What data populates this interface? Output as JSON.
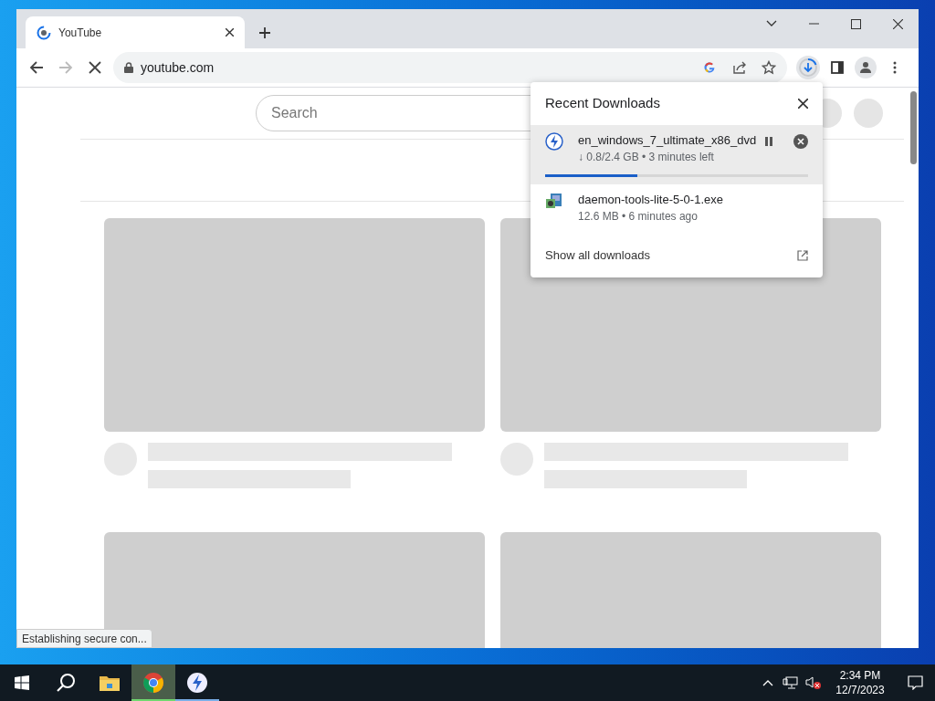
{
  "browser": {
    "tabs": [
      {
        "title": "YouTube",
        "selected": true
      }
    ],
    "address": "youtube.com",
    "loading": true
  },
  "page": {
    "search": {
      "placeholder": "Search"
    }
  },
  "downloads_popup": {
    "title": "Recent Downloads",
    "items": [
      {
        "kind": "in_progress",
        "name": "en_windows_7_ultimate_x86_dvd",
        "status": "↓ 0.8/2.4 GB • 3 minutes left",
        "level": 0.35,
        "highlighted": true
      },
      {
        "kind": "complete",
        "name": "daemon-tools-lite-5-0-1.exe",
        "status": "12.6 MB • 6 minutes ago",
        "highlighted": false
      }
    ],
    "footer": "Show all downloads"
  },
  "status_bubble": "Establishing secure con...",
  "taskbar": {
    "apps": [
      {
        "kind": "explorer",
        "selected": false,
        "running": false
      },
      {
        "kind": "chrome",
        "selected": true,
        "running": true
      },
      {
        "kind": "daemon",
        "selected": false,
        "running": true
      }
    ],
    "time": "2:34 PM",
    "date": "12/7/2023"
  }
}
